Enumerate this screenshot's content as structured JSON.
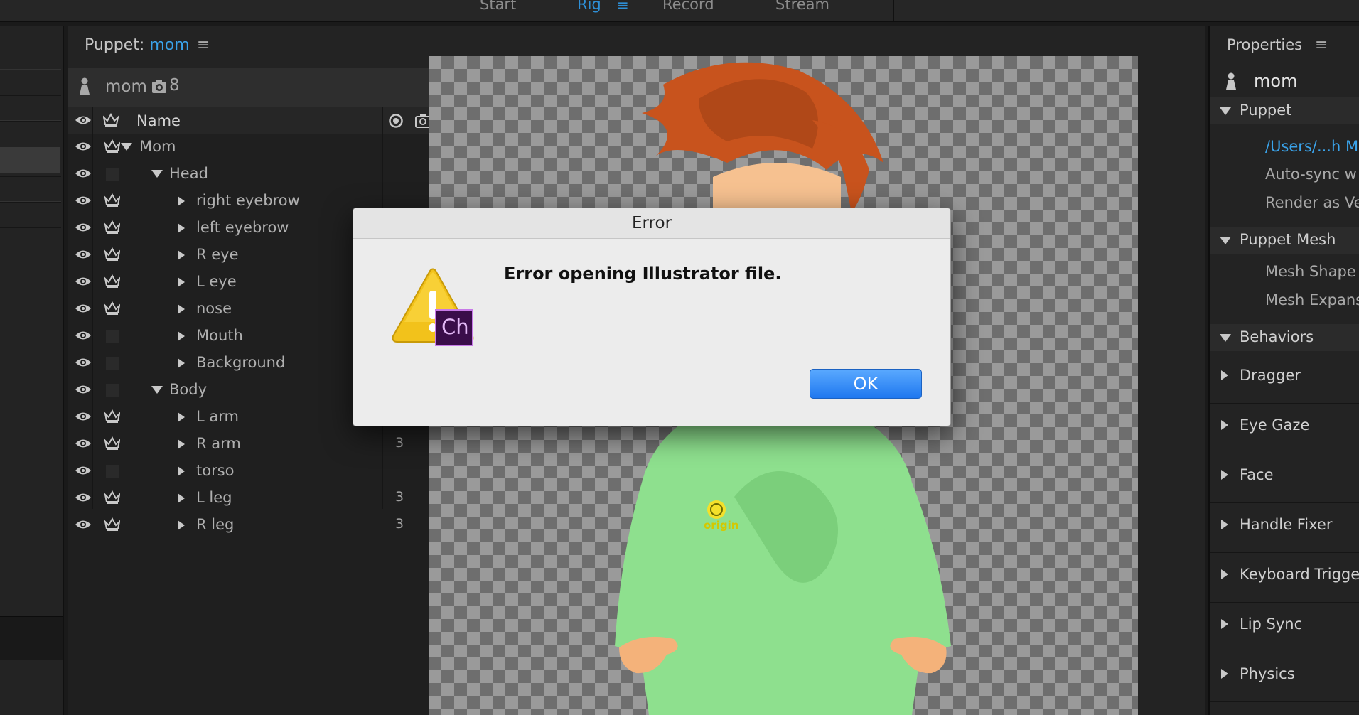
{
  "topbar": {
    "tabs": [
      {
        "label": "Start"
      },
      {
        "label": "Rig"
      },
      {
        "label": "Record"
      },
      {
        "label": "Stream"
      }
    ]
  },
  "puppet_panel": {
    "title_prefix": "Puppet:",
    "title_name": "mom",
    "header_name": "mom",
    "header_count": "8",
    "column_name": "Name",
    "layers": [
      {
        "label": "Mom",
        "depth": 0,
        "expanded": true,
        "crown": true,
        "num": ""
      },
      {
        "label": "Head",
        "depth": 1,
        "expanded": true,
        "crown": false,
        "num": ""
      },
      {
        "label": "right eyebrow",
        "depth": 2,
        "expanded": false,
        "crown": true,
        "num": ""
      },
      {
        "label": "left eyebrow",
        "depth": 2,
        "expanded": false,
        "crown": true,
        "num": ""
      },
      {
        "label": "R eye",
        "depth": 2,
        "expanded": false,
        "crown": true,
        "num": ""
      },
      {
        "label": "L eye",
        "depth": 2,
        "expanded": false,
        "crown": true,
        "num": ""
      },
      {
        "label": "nose",
        "depth": 2,
        "expanded": false,
        "crown": true,
        "num": ""
      },
      {
        "label": "Mouth",
        "depth": 2,
        "expanded": false,
        "crown": false,
        "num": ""
      },
      {
        "label": "Background",
        "depth": 2,
        "expanded": false,
        "crown": false,
        "num": ""
      },
      {
        "label": "Body",
        "depth": 1,
        "expanded": true,
        "crown": false,
        "num": ""
      },
      {
        "label": "L arm",
        "depth": 2,
        "expanded": false,
        "crown": true,
        "num": ""
      },
      {
        "label": "R arm",
        "depth": 2,
        "expanded": false,
        "crown": true,
        "num": "3"
      },
      {
        "label": "torso",
        "depth": 2,
        "expanded": false,
        "crown": false,
        "num": ""
      },
      {
        "label": "L leg",
        "depth": 2,
        "expanded": false,
        "crown": true,
        "num": "3"
      },
      {
        "label": "R leg",
        "depth": 2,
        "expanded": false,
        "crown": true,
        "num": "3"
      }
    ]
  },
  "stage": {
    "origin_label": "origin"
  },
  "properties": {
    "title": "Properties",
    "puppet_name": "mom",
    "puppet_section": "Puppet",
    "puppet_items": [
      "/Users/...h M",
      "Auto-sync w",
      "Render as Ve"
    ],
    "mesh_section": "Puppet Mesh",
    "mesh_items": [
      "Mesh Shape",
      "Mesh Expans"
    ],
    "behaviors_section": "Behaviors",
    "behaviors": [
      "Dragger",
      "Eye Gaze",
      "Face",
      "Handle Fixer",
      "Keyboard Trigge",
      "Lip Sync",
      "Physics"
    ]
  },
  "dialog": {
    "title": "Error",
    "message": "Error opening Illustrator file.",
    "ok_label": "OK",
    "badge_text": "Ch"
  },
  "colors": {
    "accent": "#3aa3ea",
    "ok_button": "#1f78ef",
    "warning_yellow": "#f2c21b",
    "character_badge": "#3a0d4a"
  }
}
